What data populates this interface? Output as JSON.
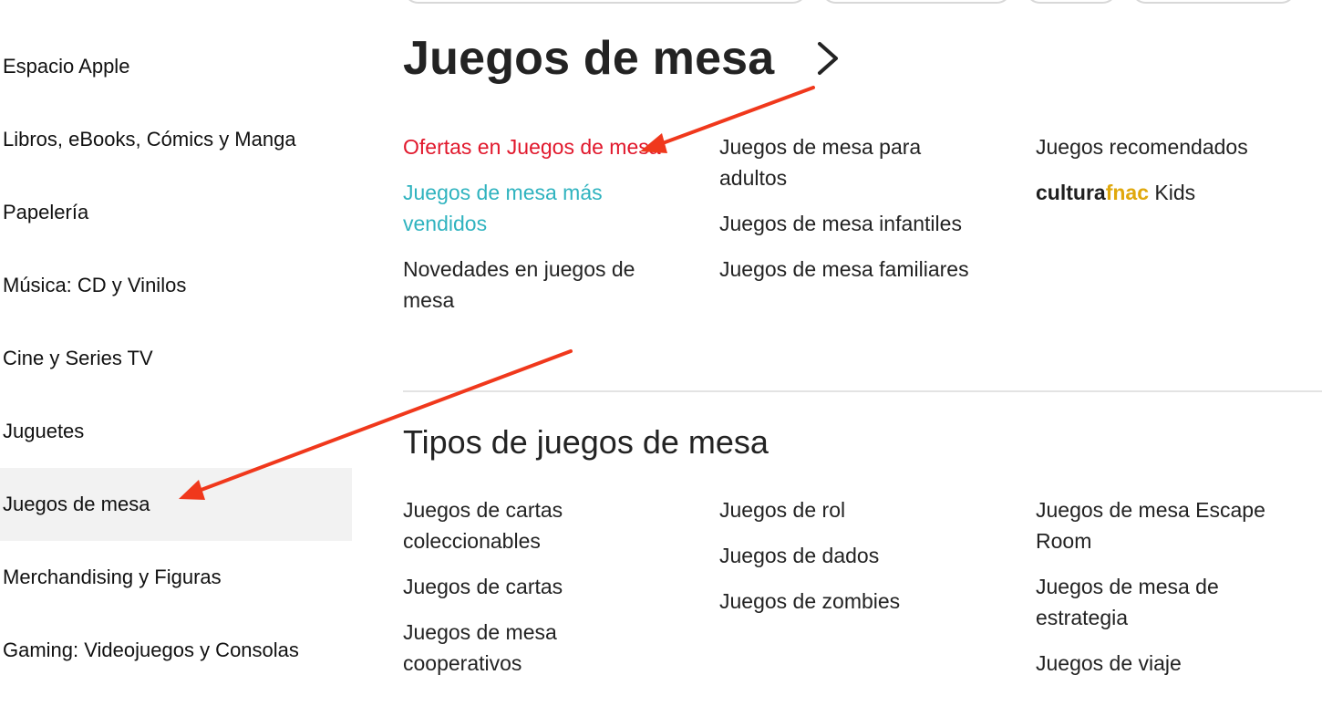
{
  "sidebar": {
    "items": [
      {
        "label": "Espacio Apple"
      },
      {
        "label": "Libros, eBooks, Cómics y Manga"
      },
      {
        "label": "Papelería"
      },
      {
        "label": "Música: CD y Vinilos"
      },
      {
        "label": "Cine y Series TV"
      },
      {
        "label": "Juguetes"
      },
      {
        "label": "Juegos de mesa"
      },
      {
        "label": "Merchandising y Figuras"
      },
      {
        "label": "Gaming: Videojuegos y Consolas"
      }
    ]
  },
  "main": {
    "title": "Juegos de mesa",
    "top_links": {
      "col1": [
        "Ofertas en Juegos de mesa",
        "Juegos de mesa más vendidos",
        "Novedades en juegos de mesa"
      ],
      "col2": [
        "Juegos de mesa para adultos",
        "Juegos de mesa infantiles",
        "Juegos de mesa familiares"
      ],
      "col3": [
        "Juegos recomendados"
      ],
      "brand": {
        "part1": "cultura",
        "part2": "fnac",
        "part3": " Kids"
      }
    },
    "section": {
      "title": "Tipos de juegos de mesa",
      "col1": [
        "Juegos de cartas coleccionables",
        "Juegos de cartas",
        "Juegos de mesa cooperativos"
      ],
      "col2": [
        "Juegos de rol",
        "Juegos de dados",
        "Juegos de zombies"
      ],
      "col3": [
        "Juegos de mesa Escape Room",
        "Juegos de mesa de estrategia",
        "Juegos de viaje"
      ]
    }
  },
  "colors": {
    "offer_red": "#e1182c",
    "bestseller_teal": "#2fb3bf",
    "fnac_gold": "#e0a80c",
    "annotation_arrow": "#f0381c",
    "active_bg": "#f2f2f2"
  },
  "icons": {
    "title_chevron": "chevron-right-icon"
  }
}
